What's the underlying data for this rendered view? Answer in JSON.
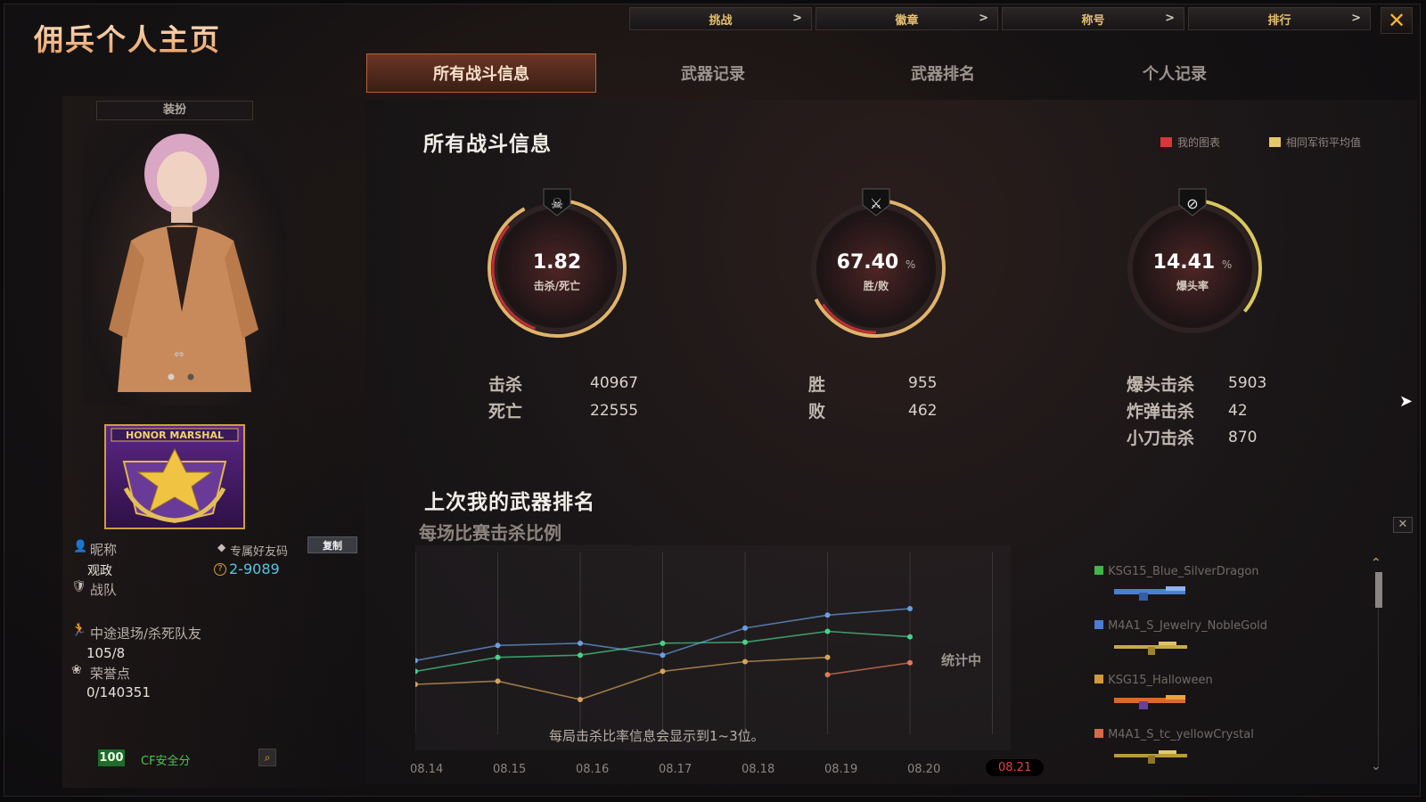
{
  "app": {
    "title": "佣兵个人主页",
    "close_icon": "close-icon"
  },
  "topnav": [
    {
      "label": "挑战"
    },
    {
      "label": "徽章"
    },
    {
      "label": "称号"
    },
    {
      "label": "排行"
    }
  ],
  "tabs": [
    {
      "label": "所有战斗信息",
      "active": true
    },
    {
      "label": "武器记录"
    },
    {
      "label": "武器排名"
    },
    {
      "label": "个人记录"
    }
  ],
  "profile": {
    "outfit_button": "装扮",
    "badge_text": "HONOR MARSHAL",
    "nickname_label": "昵称",
    "nickname_value": "观政",
    "friend_code_label": "专属好友码",
    "friend_code_value": "2-9089",
    "copy_button": "复制",
    "team_label": "战队",
    "quit_label": "中途退场/杀死队友",
    "quit_value": "105/8",
    "honor_label": "荣誉点",
    "honor_value": "0/140351",
    "security_score": "100",
    "security_label": "CF安全分"
  },
  "battle": {
    "title": "所有战斗信息",
    "legend": [
      {
        "label": "我的图表",
        "color": "#d9363a"
      },
      {
        "label": "相同军衔平均值",
        "color": "#e6c86a"
      }
    ],
    "rings": [
      {
        "value": "1.82",
        "unit": "",
        "label": "击杀/死亡",
        "icon": "skull-icon",
        "progress": 0.92
      },
      {
        "value": "67.40",
        "unit": "%",
        "label": "胜/败",
        "icon": "crossed-swords-icon",
        "progress": 0.674
      },
      {
        "value": "14.41",
        "unit": "%",
        "label": "爆头率",
        "icon": "headshot-icon",
        "progress": 0.36
      }
    ],
    "stats": {
      "kills_label": "击杀",
      "kills": "40967",
      "deaths_label": "死亡",
      "deaths": "22555",
      "wins_label": "胜",
      "wins": "955",
      "losses_label": "败",
      "losses": "462",
      "headshot_label": "爆头击杀",
      "headshot": "5903",
      "bomb_label": "炸弹击杀",
      "bomb": "42",
      "knife_label": "小刀击杀",
      "knife": "870"
    }
  },
  "ranking": {
    "title": "上次我的武器排名",
    "subtitle": "每场比赛击杀比例",
    "status": "统计中",
    "note": "每局击杀比率信息会显示到1~3位。",
    "weapons": [
      {
        "name": "KSG15_Blue_SilverDragon",
        "color": "#3fb54a"
      },
      {
        "name": "M4A1_S_Jewelry_NobleGold",
        "color": "#4b7dd0"
      },
      {
        "name": "KSG15_Halloween",
        "color": "#d29a3a"
      },
      {
        "name": "M4A1_S_tc_yellowCrystal",
        "color": "#d46a4a"
      }
    ]
  },
  "chart_data": {
    "type": "line",
    "categories": [
      "08.14",
      "08.15",
      "08.16",
      "08.17",
      "08.18",
      "08.19",
      "08.20",
      "08.21"
    ],
    "active_category": "08.21",
    "series": [
      {
        "color": "#6a9ee0",
        "values": [
          30,
          44,
          46,
          35,
          60,
          72,
          78,
          null
        ]
      },
      {
        "color": "#4bd08a",
        "values": [
          20,
          33,
          35,
          46,
          47,
          57,
          52,
          null
        ]
      },
      {
        "color": "#d6a35a",
        "values": [
          8,
          11,
          -6,
          20,
          29,
          33,
          null,
          null
        ]
      },
      {
        "color": "#e07a5a",
        "values": [
          null,
          null,
          null,
          null,
          null,
          17,
          28,
          null
        ]
      }
    ],
    "ylim": [
      -20,
      120
    ]
  }
}
